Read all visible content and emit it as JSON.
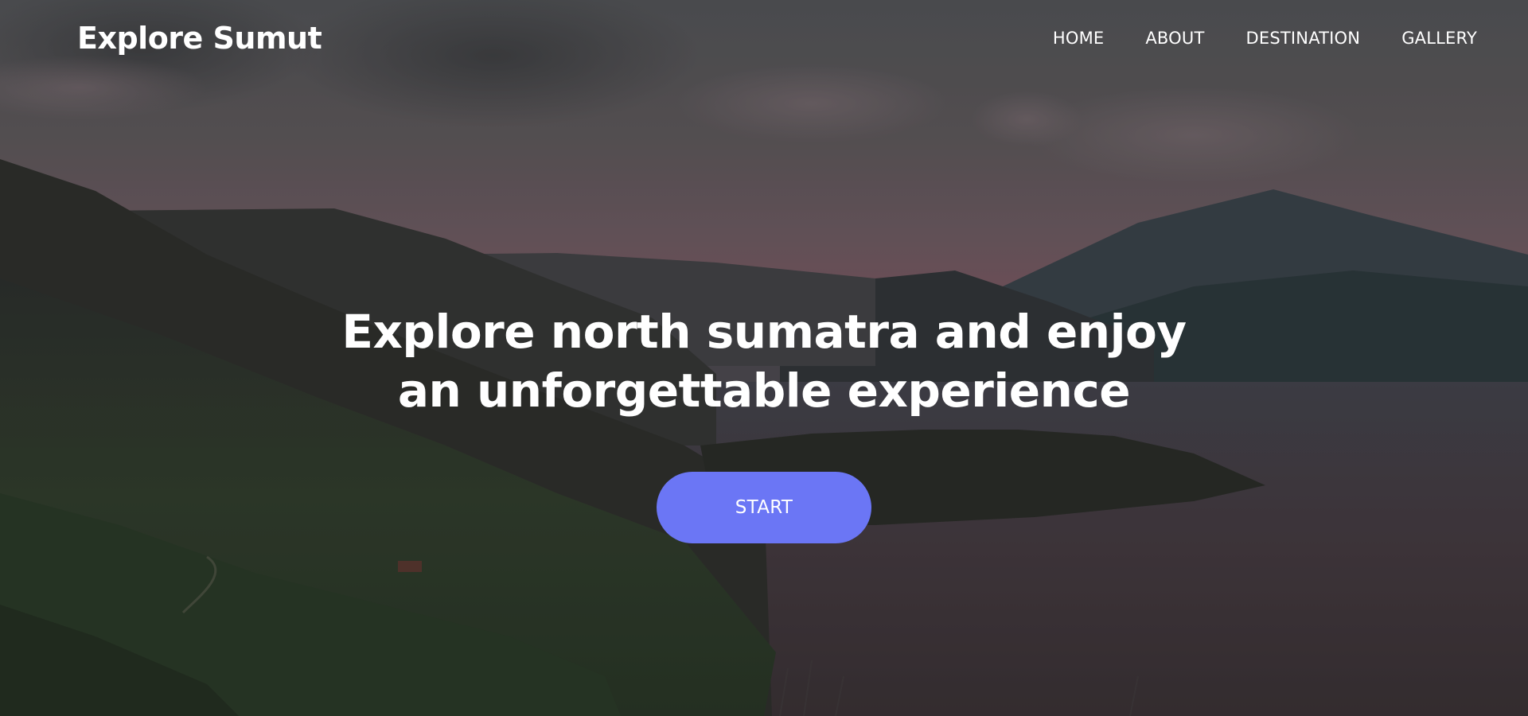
{
  "brand": {
    "name": "Explore Sumut"
  },
  "nav": {
    "items": [
      {
        "label": "HOME"
      },
      {
        "label": "ABOUT"
      },
      {
        "label": "DESTINATION"
      },
      {
        "label": "GALLERY"
      }
    ]
  },
  "hero": {
    "headline_line1": "Explore north sumatra and enjoy",
    "headline_line2": "an unforgettable experience",
    "cta_label": "START",
    "background_subject": "lake-and-mountains-landscape"
  },
  "colors": {
    "accent": "#6b76f5",
    "text": "#ffffff"
  }
}
